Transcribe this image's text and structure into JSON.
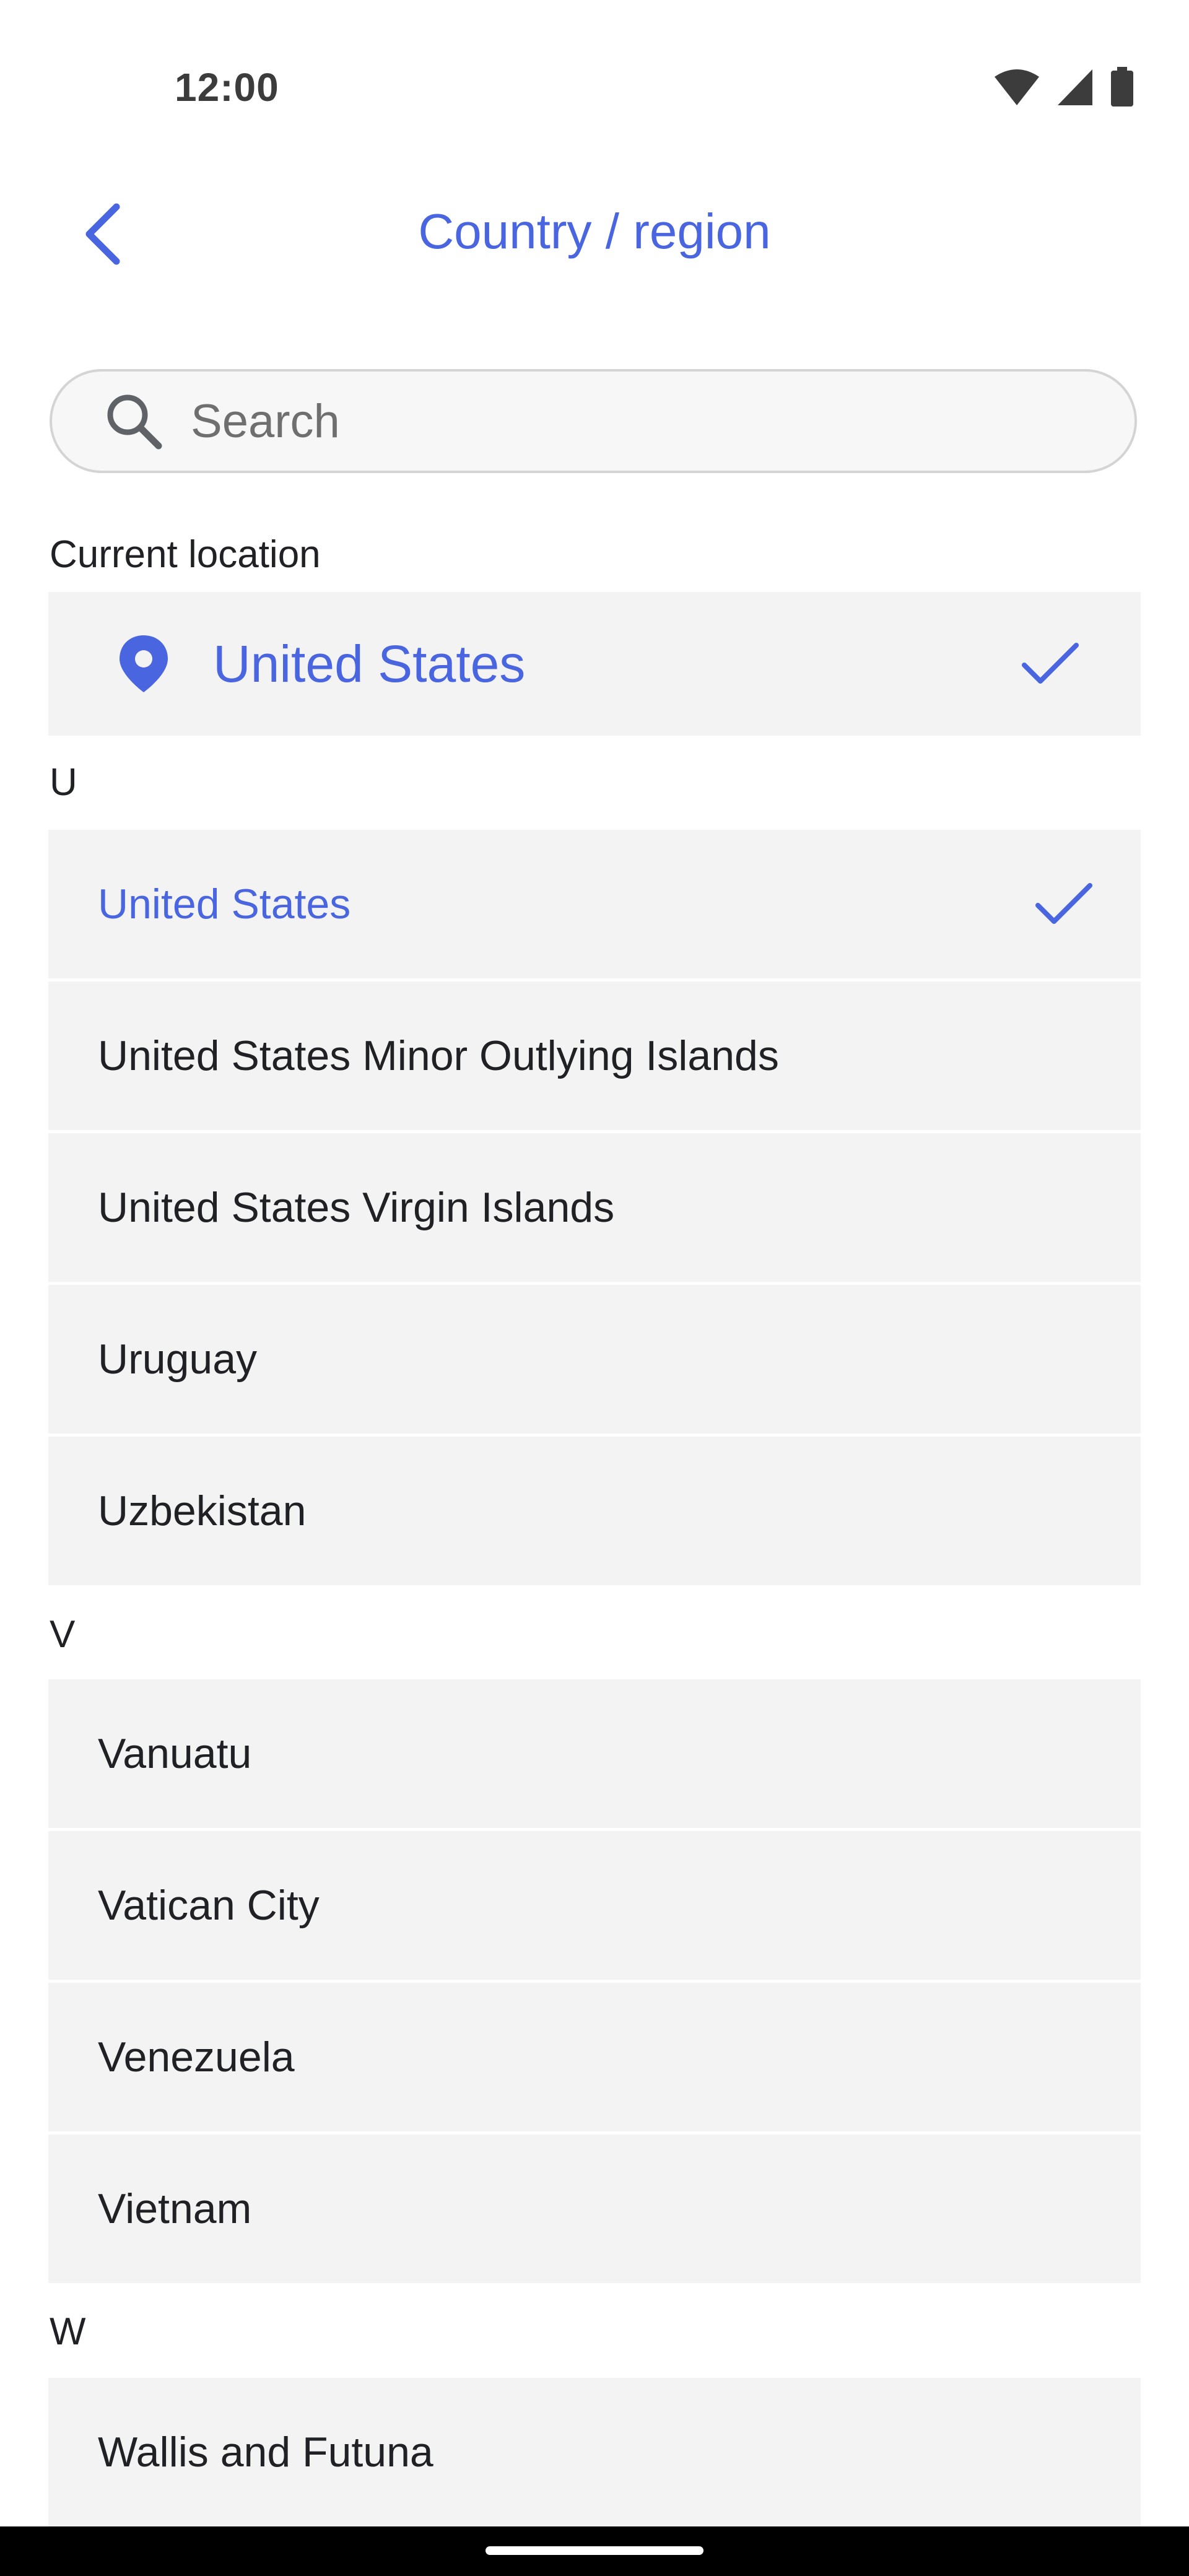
{
  "status_bar": {
    "time": "12:00",
    "icons": [
      "wifi-icon",
      "signal-icon",
      "battery-icon"
    ]
  },
  "header": {
    "title": "Country / region",
    "back_icon": "chevron-left-icon"
  },
  "search": {
    "placeholder": "Search",
    "value": ""
  },
  "current_location": {
    "section_label": "Current location",
    "country": "United States",
    "selected": true
  },
  "groups": [
    {
      "letter": "U",
      "items": [
        {
          "name": "United States",
          "selected": true
        },
        {
          "name": "United States Minor Outlying Islands",
          "selected": false
        },
        {
          "name": "United States Virgin Islands",
          "selected": false
        },
        {
          "name": "Uruguay",
          "selected": false
        },
        {
          "name": "Uzbekistan",
          "selected": false
        }
      ]
    },
    {
      "letter": "V",
      "items": [
        {
          "name": "Vanuatu",
          "selected": false
        },
        {
          "name": "Vatican City",
          "selected": false
        },
        {
          "name": "Venezuela",
          "selected": false
        },
        {
          "name": "Vietnam",
          "selected": false
        }
      ]
    },
    {
      "letter": "W",
      "items": [
        {
          "name": "Wallis and Futuna",
          "selected": false
        }
      ]
    }
  ],
  "colors": {
    "accent": "#4a65e0",
    "row_bg": "#f3f3f3",
    "text": "#202124"
  }
}
